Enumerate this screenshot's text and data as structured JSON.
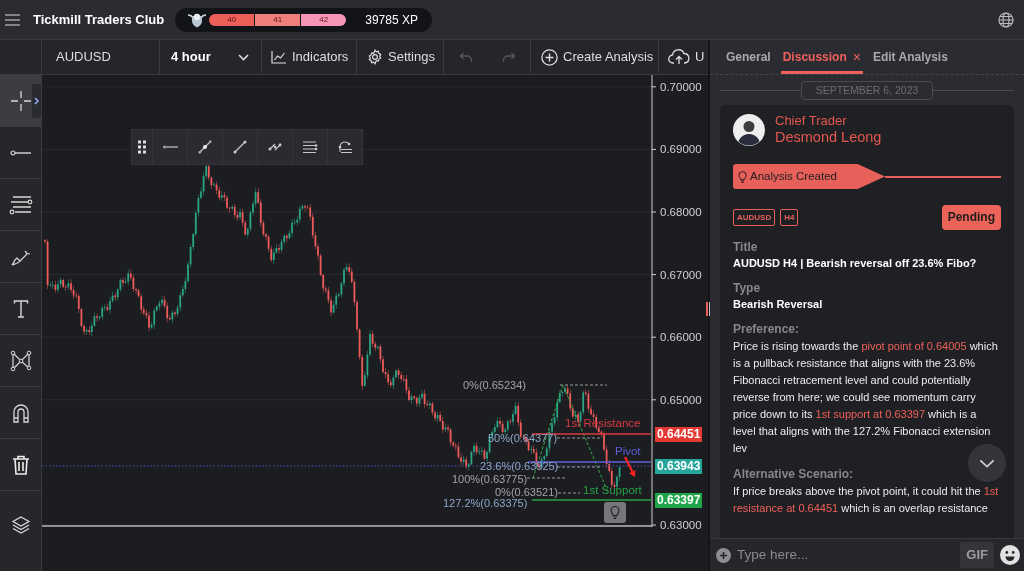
{
  "header": {
    "title": "Tickmill Traders Club",
    "levels": [
      {
        "label": "40",
        "color": "#eb5f58"
      },
      {
        "label": "41",
        "color": "#f07f7b"
      },
      {
        "label": "42",
        "color": "#f596b9"
      }
    ],
    "xp": "39785 XP"
  },
  "toolbar": {
    "symbol": "AUDUSD",
    "interval": "4 hour",
    "actions": [
      {
        "kind": "indicators",
        "label": "Indicators",
        "disabled": false
      },
      {
        "kind": "settings",
        "label": "Settings",
        "disabled": false
      },
      {
        "kind": "undo",
        "disabled": true
      },
      {
        "kind": "redo",
        "disabled": true
      },
      {
        "kind": "create",
        "label": "Create Analysis",
        "disabled": false
      },
      {
        "kind": "upload",
        "label": "U",
        "disabled": false
      }
    ]
  },
  "drawing_tools": [
    {
      "kind": "crosshair",
      "selected": true
    },
    {
      "kind": "line",
      "selected": false
    },
    {
      "kind": "parallel",
      "selected": false
    },
    {
      "kind": "brush",
      "selected": false
    },
    {
      "kind": "text",
      "selected": false
    },
    {
      "kind": "pattern",
      "selected": false
    },
    {
      "kind": "magnet",
      "selected": false
    },
    {
      "kind": "trash",
      "selected": false
    },
    {
      "kind": "layers",
      "selected": false
    }
  ],
  "floating_toolbar": [
    {
      "kind": "grip"
    },
    {
      "kind": "ray"
    },
    {
      "kind": "trend"
    },
    {
      "kind": "segment"
    },
    {
      "kind": "parallel"
    },
    {
      "kind": "levels"
    },
    {
      "kind": "curve"
    }
  ],
  "chart": {
    "price_ticks": [
      "0.70000",
      "0.69000",
      "0.68000",
      "0.67000",
      "0.66000",
      "0.65000",
      "0.63000"
    ],
    "fib_labels": [
      {
        "label": "0%(0.65234)",
        "color": "#a3a3a3"
      },
      {
        "label": "50%(0.64377)",
        "color": "#8ea6c8"
      },
      {
        "label": "23.6%(0.63925)",
        "color": "#8ea6c8"
      },
      {
        "label": "100%(0.63775)",
        "color": "#a3a3a3"
      },
      {
        "label": "0%(0.63521)",
        "color": "#a3a3a3"
      },
      {
        "label": "127.2%(0.63375)",
        "color": "#8ea6c8"
      }
    ],
    "levels": [
      {
        "label": "1st Resistance",
        "color": "#d93a3e"
      },
      {
        "label": "Pivot",
        "color": "#5d5fd8"
      },
      {
        "label": "1st Support",
        "color": "#25a244"
      }
    ],
    "price_tags": [
      {
        "label": "0.64451",
        "color": "#e53935"
      },
      {
        "label": "0.63943",
        "color": "#26a69a"
      },
      {
        "label": "0.63397",
        "color": "#1fa64a"
      }
    ]
  },
  "panel": {
    "tabs": [
      {
        "label": "General",
        "selected": false
      },
      {
        "label": "Discussion",
        "selected": true,
        "close": "×"
      },
      {
        "label": "Edit Analysis",
        "selected": false
      }
    ],
    "date": "SEPTEMBER 6, 2023",
    "post": {
      "role": "Chief Trader",
      "author": "Desmond Leong",
      "event": "Analysis Created",
      "tags": [
        "AUDUSD",
        "H4"
      ],
      "status": "Pending",
      "fields": [
        {
          "kind": "short",
          "label": "Title",
          "value": "AUDUSD H4 | Bearish reversal off 23.6% Fibo?"
        },
        {
          "kind": "short",
          "label": "Type",
          "value": "Bearish Reversal"
        },
        {
          "kind": "long",
          "label": "Preference:",
          "value": "Price is rising towards the **pivot point of 0.64005** which is a pullback resistance that aligns with the 23.6% Fibonacci retracement level and could potentially reverse from here; we could see momentum carry price down to its **1st support at 0.63397** which is a level that aligns with the 127.2% Fibonacci extension lev"
        },
        {
          "kind": "long",
          "label": "Alternative Scenario:",
          "value": "If price breaks above the pivot point, it could hit the **1st resistance at 0.64451** which is an overlap resistance"
        }
      ]
    },
    "composer": {
      "placeholder": "Type here...",
      "gif": "GIF"
    }
  }
}
